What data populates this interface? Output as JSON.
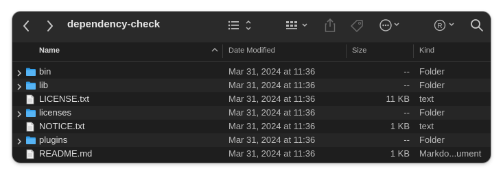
{
  "window": {
    "title": "dependency-check"
  },
  "toolbar": {
    "icons": [
      "back-icon",
      "forward-icon",
      "list-view-icon",
      "group-icon",
      "share-icon",
      "tag-icon",
      "more-icon",
      "registered-icon",
      "search-icon"
    ]
  },
  "columns": {
    "name": "Name",
    "date": "Date Modified",
    "size": "Size",
    "kind": "Kind"
  },
  "files": [
    {
      "name": "bin",
      "date": "Mar 31, 2024 at 11:36",
      "size": "--",
      "kind": "Folder",
      "type": "folder"
    },
    {
      "name": "lib",
      "date": "Mar 31, 2024 at 11:36",
      "size": "--",
      "kind": "Folder",
      "type": "folder"
    },
    {
      "name": "LICENSE.txt",
      "date": "Mar 31, 2024 at 11:36",
      "size": "11 KB",
      "kind": "text",
      "type": "file"
    },
    {
      "name": "licenses",
      "date": "Mar 31, 2024 at 11:36",
      "size": "--",
      "kind": "Folder",
      "type": "folder"
    },
    {
      "name": "NOTICE.txt",
      "date": "Mar 31, 2024 at 11:36",
      "size": "1 KB",
      "kind": "text",
      "type": "file"
    },
    {
      "name": "plugins",
      "date": "Mar 31, 2024 at 11:36",
      "size": "--",
      "kind": "Folder",
      "type": "folder"
    },
    {
      "name": "README.md",
      "date": "Mar 31, 2024 at 11:36",
      "size": "1 KB",
      "kind": "Markdo...ument",
      "type": "file"
    }
  ],
  "colors": {
    "folder": "#2f9ce8",
    "window_bg": "#1e1e1e",
    "toolbar_bg": "#2a2a2a"
  }
}
